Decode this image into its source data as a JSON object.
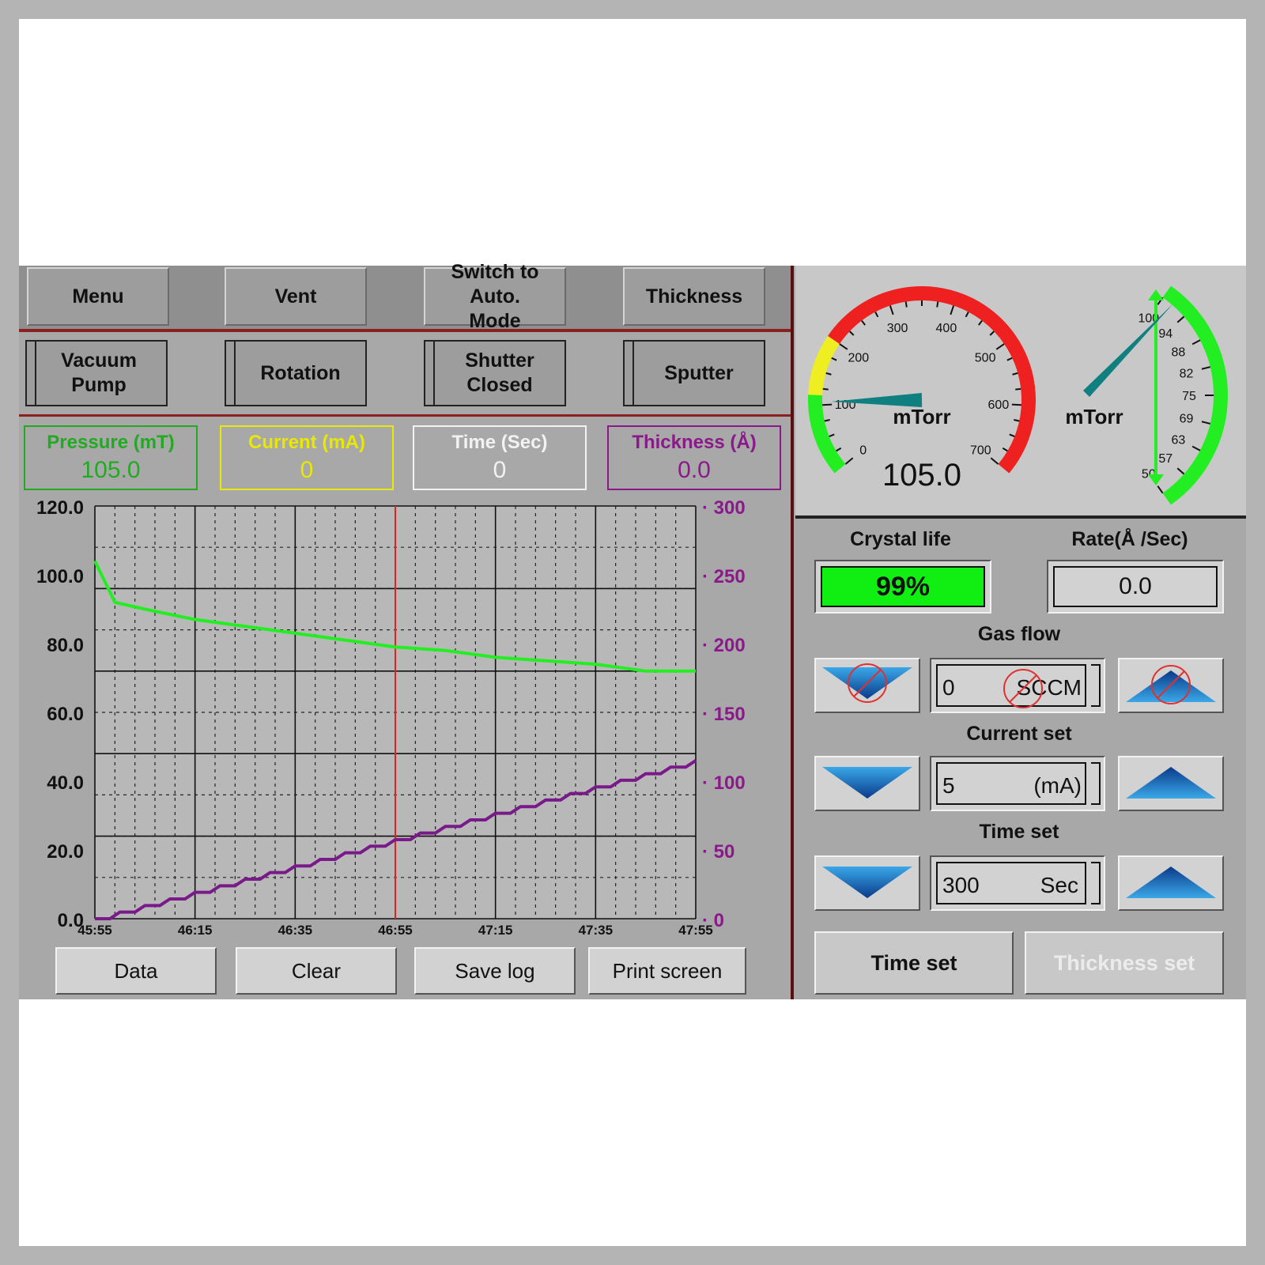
{
  "top_buttons": [
    {
      "label": "Menu"
    },
    {
      "label": "Vent"
    },
    {
      "label": "Switch to Auto. Mode"
    },
    {
      "label": "Thickness"
    }
  ],
  "toggle_buttons": [
    {
      "label": "Vacuum Pump"
    },
    {
      "label": "Rotation"
    },
    {
      "label": "Shutter Closed"
    },
    {
      "label": "Sputter"
    }
  ],
  "status": {
    "pressure": {
      "title": "Pressure (mT)",
      "value": "105.0",
      "color": "#22aa22"
    },
    "current": {
      "title": "Current (mA)",
      "value": "0",
      "color": "#e8e800"
    },
    "time": {
      "title": "Time (Sec)",
      "value": "0",
      "color": "#f2f2f2"
    },
    "thickness": {
      "title": "Thickness (Å)",
      "value": "0.0",
      "color": "#8a1a8a"
    }
  },
  "chart_data": {
    "type": "line",
    "x": [
      "45:55",
      "46:15",
      "46:35",
      "46:55",
      "47:15",
      "47:35",
      "47:55"
    ],
    "y_left_ticks": [
      "120.0",
      "100.0",
      "80.0",
      "60.0",
      "40.0",
      "20.0",
      "0.0"
    ],
    "y_right_ticks": [
      "300",
      "250",
      "200",
      "150",
      "100",
      "50",
      "0"
    ],
    "ylim_left": [
      0,
      120
    ],
    "ylim_right": [
      0,
      300
    ],
    "cursor_x_seconds": 60,
    "series": [
      {
        "axis": "left",
        "color": "#22ee22",
        "points": [
          [
            0,
            104
          ],
          [
            4,
            92
          ],
          [
            10,
            90
          ],
          [
            20,
            87
          ],
          [
            30,
            85
          ],
          [
            40,
            83
          ],
          [
            50,
            81
          ],
          [
            60,
            79
          ],
          [
            70,
            78
          ],
          [
            80,
            76
          ],
          [
            90,
            75
          ],
          [
            100,
            74
          ],
          [
            110,
            72
          ],
          [
            120,
            72
          ]
        ]
      },
      {
        "axis": "right",
        "color": "#7a1a8a",
        "points": [
          [
            0,
            0
          ],
          [
            120,
            115
          ]
        ],
        "stepped": true,
        "steps": 24
      }
    ]
  },
  "bottom_buttons": [
    {
      "label": "Data"
    },
    {
      "label": "Clear"
    },
    {
      "label": "Save log"
    },
    {
      "label": "Print screen"
    }
  ],
  "gauge_left": {
    "ticks": [
      "0",
      "100",
      "200",
      "300",
      "400",
      "500",
      "600",
      "700"
    ],
    "unit": "mTorr",
    "value": "105.0",
    "needle_value": 105
  },
  "gauge_right": {
    "ticks": [
      "100",
      "94",
      "88",
      "82",
      "75",
      "69",
      "63",
      "57",
      "50"
    ],
    "unit": "mTorr"
  },
  "crystal_life": {
    "label": "Crystal life",
    "value": "99%"
  },
  "rate": {
    "label": "Rate(Å /Sec)",
    "value": "0.0"
  },
  "gas_flow": {
    "label": "Gas flow",
    "value": "0",
    "unit": "SCCM"
  },
  "current_set": {
    "label": "Current set",
    "value": "5",
    "unit": "(mA)"
  },
  "time_set": {
    "label": "Time set",
    "value": "300",
    "unit": "Sec"
  },
  "action_buttons": {
    "time_set": "Time set",
    "thickness_set": "Thickness set"
  }
}
